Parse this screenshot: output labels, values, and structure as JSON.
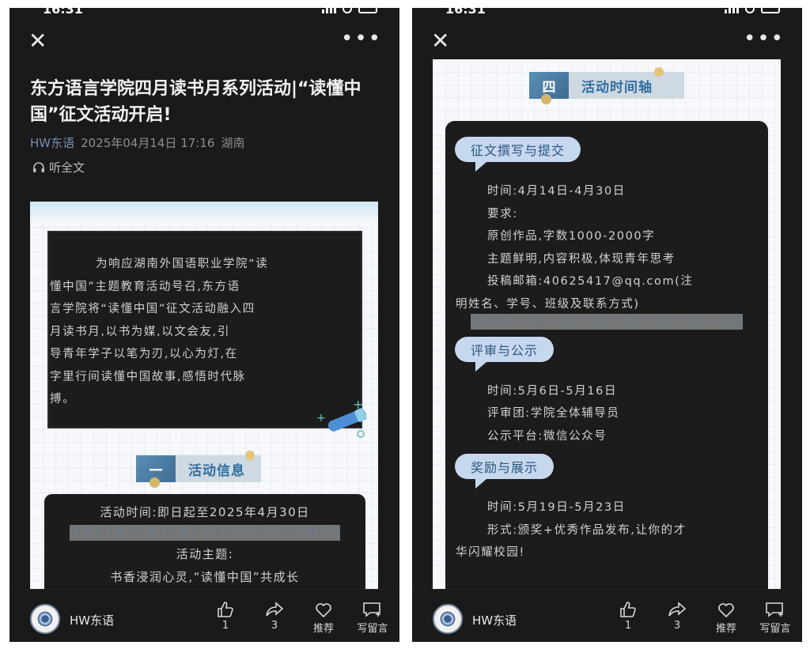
{
  "status": {
    "time": "16:31"
  },
  "left": {
    "title": "东方语言学院四月读书月系列活动|“读懂中国”征文活动开启!",
    "meta": {
      "author": "HW东语",
      "date": "2025年04月14日 17:16",
      "location": "湖南"
    },
    "listen_label": "听全文",
    "intro_lines": [
      "为响应湖南外国语职业学院“读",
      "懂中国”主题教育活动号召,东方语",
      "言学院将“读懂中国”征文活动融入四",
      "月读书月,以书为媒,以文会友,引",
      "导青年学子以笔为刃,以心为灯,在",
      "字里行间读懂中国故事,感悟时代脉",
      "搏。"
    ],
    "section": {
      "num": "一",
      "label": "活动信息"
    },
    "info": {
      "time": "活动时间:即日起至2025年4月30日",
      "theme_label": "活动主题:",
      "theme": "书香浸润心灵,“读懂中国”共成长"
    }
  },
  "right": {
    "section": {
      "num": "四",
      "label": "活动时间轴"
    },
    "stages": [
      {
        "tag": "征文撰写与提交",
        "lines": [
          "时间:4月14日-4月30日",
          "要求:",
          "原创作品,字数1000-2000字",
          "主题鲜明,内容积极,体现青年思考",
          "投稿邮箱:40625417@qq.com(注",
          "明姓名、学号、班级及联系方式)"
        ]
      },
      {
        "tag": "评审与公示",
        "lines": [
          "时间:5月6日-5月16日",
          "评审团:学院全体辅导员",
          "公示平台:微信公众号"
        ]
      },
      {
        "tag": "奖励与展示",
        "lines": [
          "时间:5月19日-5月23日",
          "形式:颁奖+优秀作品发布,让你的才",
          "华闪耀校园!"
        ]
      }
    ]
  },
  "bottom_bar": {
    "account": "HW东语",
    "like_count": "1",
    "share_count": "3",
    "recommend_label": "推荐",
    "comment_label": "写留言"
  }
}
